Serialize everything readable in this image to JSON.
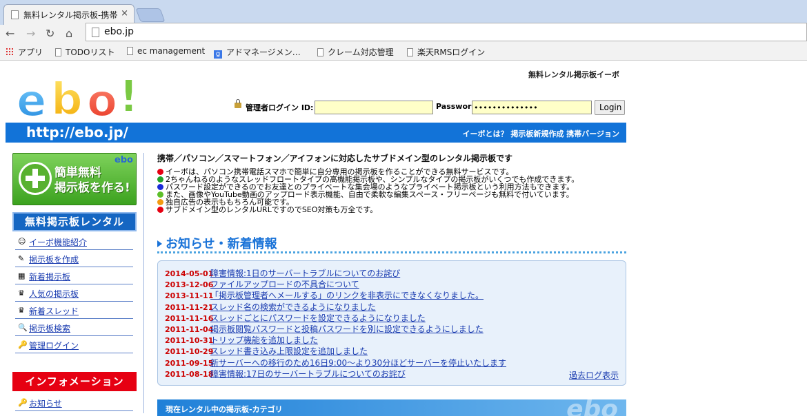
{
  "browser": {
    "tab_title": "無料レンタル掲示板-携帯",
    "tab_close": "×",
    "url": "ebo.jp",
    "bookmarks": [
      {
        "label": "アプリ",
        "icon": "apps-icon"
      },
      {
        "label": "TODOリスト",
        "icon": "page-icon"
      },
      {
        "label": "ec management",
        "icon": "page-icon"
      },
      {
        "label": "アドマネージメン…",
        "icon": "google-icon"
      },
      {
        "label": "クレーム対応管理",
        "icon": "page-icon"
      },
      {
        "label": "楽天RMSログイン",
        "icon": "page-icon"
      }
    ]
  },
  "header": {
    "logo_text": "ebo!",
    "site_title": "無料レンタル掲示板イーボ",
    "login_label": "管理者ログイン ID:",
    "id_value": "",
    "password_label": "Password:",
    "password_value": "••••••••••••••",
    "login_button": "Login",
    "url_banner": "http://ebo.jp/",
    "nav_links": "イーボとは？ 掲示板新規作成 携帯バージョン"
  },
  "sidebar": {
    "create_button_line1": "簡単無料",
    "create_button_line2": "掲示板を作る!",
    "create_button_logo": "ebo",
    "rental_heading": "無料掲示板レンタル",
    "menu": [
      {
        "label": "イーボ機能紹介",
        "icon": "☺"
      },
      {
        "label": "掲示板を作成",
        "icon": "✎"
      },
      {
        "label": "新着掲示板",
        "icon": "▦"
      },
      {
        "label": "人気の掲示板",
        "icon": "♛"
      },
      {
        "label": "新着スレッド",
        "icon": "♛"
      },
      {
        "label": "掲示板検索",
        "icon": "🔍"
      },
      {
        "label": "管理ログイン",
        "icon": "🔑"
      }
    ],
    "info_heading": "インフォメーション",
    "info_menu": [
      {
        "label": "お知らせ",
        "icon": "🔑"
      }
    ]
  },
  "main": {
    "lead": "携帯／パソコン／スマートフォン／アイフォンに対応したサブドメイン型のレンタル掲示板です",
    "features": [
      {
        "text": "イーボは、パソコン携帯電話スマホで簡単に自分専用の掲示板を作ることができる無料サービスです。",
        "color": "#e60012"
      },
      {
        "text": "2ちゃんねるのようなスレッドフロートタイプの高機能掲示板や、シンプルなタイプの掲示板がいくつでも作成できます。",
        "color": "#22a32a"
      },
      {
        "text": "パスワード設定ができるのでお友達とのプライベートな集会場のようなプライベート掲示板という利用方法もできます。",
        "color": "#1a2bd8"
      },
      {
        "text": "また、画像やYouTube動画のアップロード表示機能、自由で柔軟な編集スペース・フリーページも無料で付いています。",
        "color": "#5dbf2a"
      },
      {
        "text": "独自広告の表示ももちろん可能です。",
        "color": "#f39a11"
      },
      {
        "text": "サブドメイン型のレンタルURLですのでSEO対策も万全です。",
        "color": "#e60012"
      }
    ],
    "news_heading": "お知らせ・新着情報",
    "news": [
      {
        "date": "2014-05-01",
        "text": "障害情報:1日のサーバートラブルについてのお詫び"
      },
      {
        "date": "2013-12-06",
        "text": "ファイルアップロードの不具合について"
      },
      {
        "date": "2013-11-11",
        "text": "「掲示板管理者へメールする」のリンクを非表示にできなくなりました。"
      },
      {
        "date": "2011-11-21",
        "text": "スレッド名の検索ができるようになりました"
      },
      {
        "date": "2011-11-16",
        "text": "スレッドごとにパスワードを設定できるようになりました"
      },
      {
        "date": "2011-11-04",
        "text": "掲示板閲覧パスワードと投稿パスワードを別に設定できるようにしました"
      },
      {
        "date": "2011-10-31",
        "text": "トリップ機能を追加しました"
      },
      {
        "date": "2011-10-29",
        "text": "スレッド書き込み上限設定を追加しました"
      },
      {
        "date": "2011-09-15",
        "text": "新サーバーへの移行のため16日9:00～より30分ほどサーバーを停止いたします"
      },
      {
        "date": "2011-08-18",
        "text": "障害情報:17日のサーバートラブルについてのお詫び"
      }
    ],
    "past_log": "過去ログ表示",
    "category_heading": "現在レンタル中の掲示板-カテゴリ",
    "category_watermark": "ebo"
  }
}
